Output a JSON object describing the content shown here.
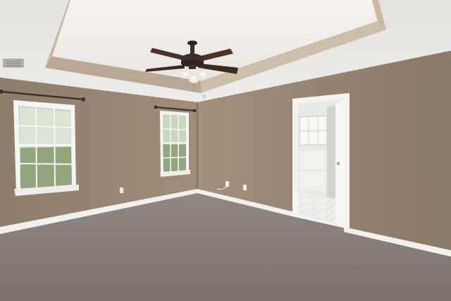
{
  "scene": {
    "description_free": true,
    "colors": {
      "wall": "#9a8775",
      "wall_shadow": "#7f6e5f",
      "ceiling": "#e8e6e3",
      "tray_ceiling": "#f1efec",
      "tray_trim": "#c4b3a1",
      "carpet": "#857d77",
      "baseboard": "#f2f0ec",
      "window_frame": "#f5f5f3",
      "window_glass": "#c9d6c0",
      "foliage": "#7f9469",
      "door_trim": "#f4f3f0",
      "bathroom_wall": "#e9e8e4",
      "tile_floor": "#ececea",
      "fan_body": "#3b2f28",
      "fan_blade": "#4a3326",
      "fan_light": "#f3f1ec",
      "curtain_rod": "#3a342f",
      "vent": "#a9a7a3",
      "outlet": "#efede8"
    },
    "items": [
      "tray-ceiling",
      "ceiling-fan",
      "left-window",
      "center-window",
      "bathroom-doorway",
      "curtain-rods",
      "wall-outlets",
      "air-vent",
      "carpet-floor"
    ]
  }
}
